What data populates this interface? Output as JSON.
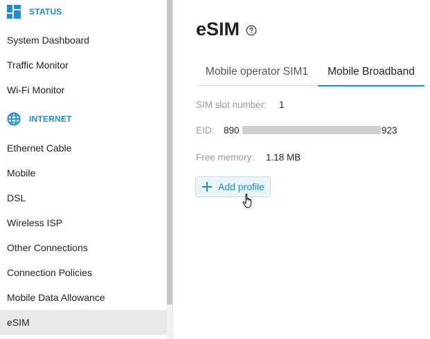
{
  "sidebar": {
    "status_section": {
      "title": "STATUS",
      "icon": "dashboard-icon"
    },
    "status_items": [
      {
        "label": "System Dashboard"
      },
      {
        "label": "Traffic Monitor"
      },
      {
        "label": "Wi-Fi Monitor"
      }
    ],
    "internet_section": {
      "title": "INTERNET",
      "icon": "globe-icon"
    },
    "internet_items": [
      {
        "label": "Ethernet Cable"
      },
      {
        "label": "Mobile"
      },
      {
        "label": "DSL"
      },
      {
        "label": "Wireless ISP"
      },
      {
        "label": "Other Connections"
      },
      {
        "label": "Connection Policies"
      },
      {
        "label": "Mobile Data Allowance"
      },
      {
        "label": "eSIM",
        "active": true
      }
    ]
  },
  "main": {
    "title": "eSIM",
    "tabs": [
      {
        "label": "Mobile operator SIM1"
      },
      {
        "label": "Mobile Broadband",
        "active": true
      }
    ],
    "fields": {
      "sim_slot_label": "SIM slot number:",
      "sim_slot_value": "1",
      "eid_label": "EID:",
      "eid_prefix": "890",
      "eid_suffix": "923",
      "free_memory_label": "Free memory:",
      "free_memory_value": "1.18 MB"
    },
    "add_profile_label": "Add profile"
  },
  "colors": {
    "accent": "#1b8ed0",
    "active_bg": "#e9e9e9",
    "muted_text": "#9a9a9a"
  }
}
